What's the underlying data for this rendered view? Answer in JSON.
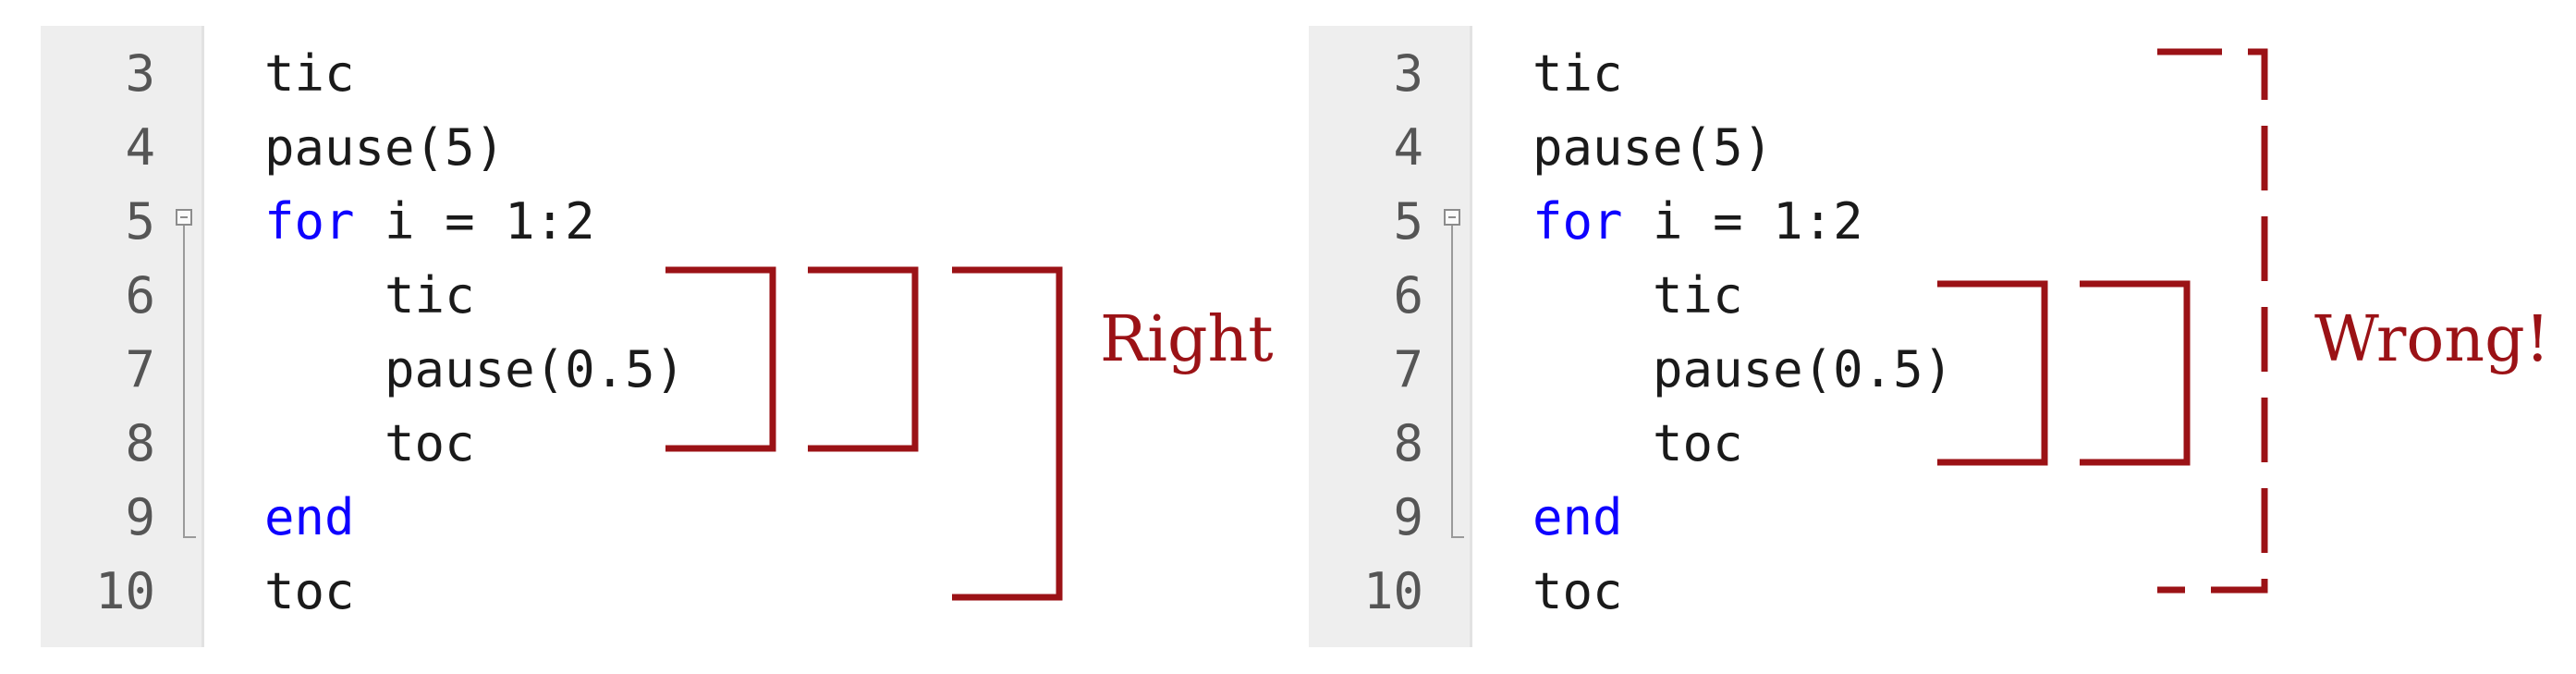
{
  "colors": {
    "keyword": "#0e00ff",
    "bracket": "#9b1216",
    "gutter": "#eeeeee"
  },
  "panels": [
    {
      "label": "Right",
      "lines": [
        {
          "num": "3",
          "parts": [
            {
              "text": "tic",
              "kw": false
            }
          ]
        },
        {
          "num": "4",
          "parts": [
            {
              "text": "pause(5)",
              "kw": false
            }
          ]
        },
        {
          "num": "5",
          "parts": [
            {
              "text": "for",
              "kw": true
            },
            {
              "text": " i = 1:2",
              "kw": false
            }
          ]
        },
        {
          "num": "6",
          "parts": [
            {
              "text": "    tic",
              "kw": false
            }
          ]
        },
        {
          "num": "7",
          "parts": [
            {
              "text": "    pause(0.5)",
              "kw": false
            }
          ]
        },
        {
          "num": "8",
          "parts": [
            {
              "text": "    toc",
              "kw": false
            }
          ]
        },
        {
          "num": "9",
          "parts": [
            {
              "text": "end",
              "kw": true
            }
          ]
        },
        {
          "num": "10",
          "parts": [
            {
              "text": "toc",
              "kw": false
            }
          ]
        }
      ]
    },
    {
      "label": "Wrong!",
      "lines": [
        {
          "num": "3",
          "parts": [
            {
              "text": "tic",
              "kw": false
            }
          ]
        },
        {
          "num": "4",
          "parts": [
            {
              "text": "pause(5)",
              "kw": false
            }
          ]
        },
        {
          "num": "5",
          "parts": [
            {
              "text": "for",
              "kw": true
            },
            {
              "text": " i = 1:2",
              "kw": false
            }
          ]
        },
        {
          "num": "6",
          "parts": [
            {
              "text": "    tic",
              "kw": false
            }
          ]
        },
        {
          "num": "7",
          "parts": [
            {
              "text": "    pause(0.5)",
              "kw": false
            }
          ]
        },
        {
          "num": "8",
          "parts": [
            {
              "text": "    toc",
              "kw": false
            }
          ]
        },
        {
          "num": "9",
          "parts": [
            {
              "text": "end",
              "kw": true
            }
          ]
        },
        {
          "num": "10",
          "parts": [
            {
              "text": "toc",
              "kw": false
            }
          ]
        }
      ]
    }
  ]
}
